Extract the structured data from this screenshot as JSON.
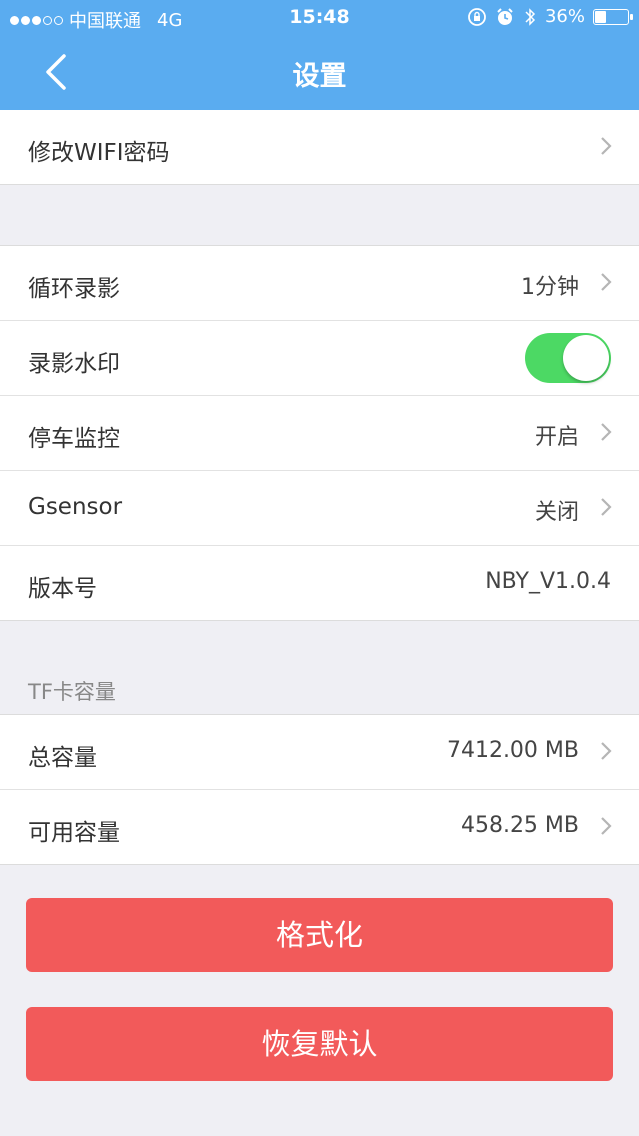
{
  "status": {
    "carrier": "中国联通",
    "network": "4G",
    "time": "15:48",
    "battery": "36%",
    "battery_level": 0.36
  },
  "nav": {
    "title": "设置"
  },
  "wifi": {
    "label": "修改WIFI密码"
  },
  "video": {
    "loop": {
      "label": "循环录影",
      "value": "1分钟"
    },
    "watermark": {
      "label": "录影水印",
      "enabled": true
    },
    "parking": {
      "label": "停车监控",
      "value": "开启"
    },
    "gsensor": {
      "label": "Gsensor",
      "value": "关闭"
    },
    "version": {
      "label": "版本号",
      "value": "NBY_V1.0.4"
    }
  },
  "tf": {
    "header": "TF卡容量",
    "total": {
      "label": "总容量",
      "value": "7412.00 MB"
    },
    "available": {
      "label": "可用容量",
      "value": "458.25 MB"
    }
  },
  "actions": {
    "format_label": "格式化",
    "reset_label": "恢复默认"
  },
  "colors": {
    "nav_bg": "#5aacf0",
    "toggle_on": "#4cd964",
    "button_red": "#f25a5a"
  }
}
